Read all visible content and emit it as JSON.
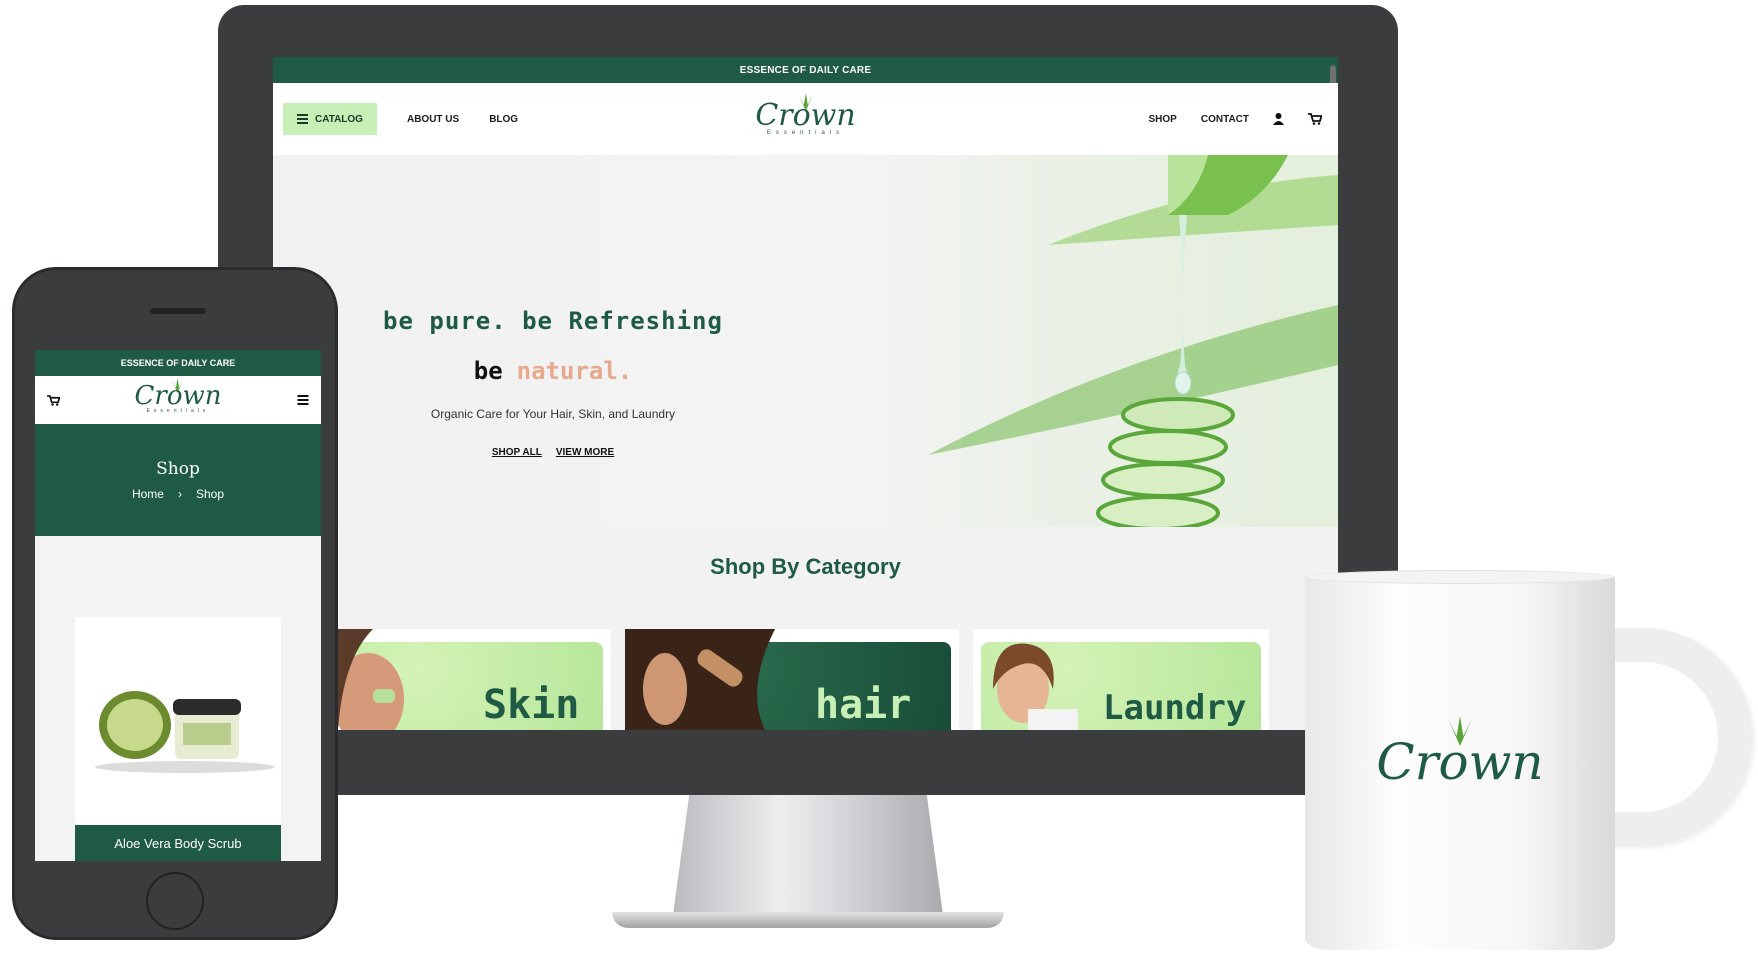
{
  "desktop": {
    "top_strip": "ESSENCE OF DAILY CARE",
    "nav": {
      "catalog": "CATALOG",
      "about": "ABOUT US",
      "blog": "BLOG",
      "shop": "SHOP",
      "contact": "CONTACT"
    },
    "logo": {
      "name": "Crown",
      "sub": "Essentials"
    },
    "hero": {
      "line1": "be pure. be Refreshing",
      "line2_be": "be",
      "line2_natural": "natural.",
      "subtitle": "Organic Care for Your Hair, Skin, and Laundry",
      "btn_shop_all": "SHOP ALL",
      "btn_view_more": "VIEW MORE"
    },
    "shop_title": "Shop By Category",
    "categories": [
      "Skin",
      "hair",
      "Laundry"
    ]
  },
  "mobile": {
    "top_strip": "ESSENCE OF DAILY CARE",
    "logo": {
      "name": "Crown",
      "sub": "Essentials"
    },
    "band_title": "Shop",
    "crumb_home": "Home",
    "crumb_sep": "›",
    "crumb_current": "Shop",
    "product_title": "Aloe Vera Body Scrub"
  },
  "mug": {
    "logo": "Crown"
  },
  "colors": {
    "brand_green": "#1f5a44",
    "light_green": "#c8efb5",
    "accent_peach": "#e7a98d"
  }
}
